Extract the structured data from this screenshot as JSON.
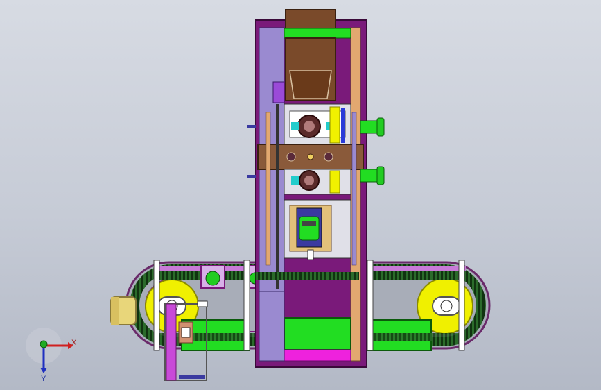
{
  "view": {
    "axes": {
      "x_label": "X",
      "y_label": "Y"
    }
  },
  "colors": {
    "frame_purple": "#7a1a7a",
    "panel_lavender": "#9a8ad0",
    "hopper_brown": "#7a4a2a",
    "green": "#22dd22",
    "yellow": "#f0f000",
    "pink": "#ee22dd",
    "tan": "#e2a870",
    "chain_dark": "#1f4a1f"
  },
  "icons": {
    "triad": "axis-triad-icon"
  }
}
